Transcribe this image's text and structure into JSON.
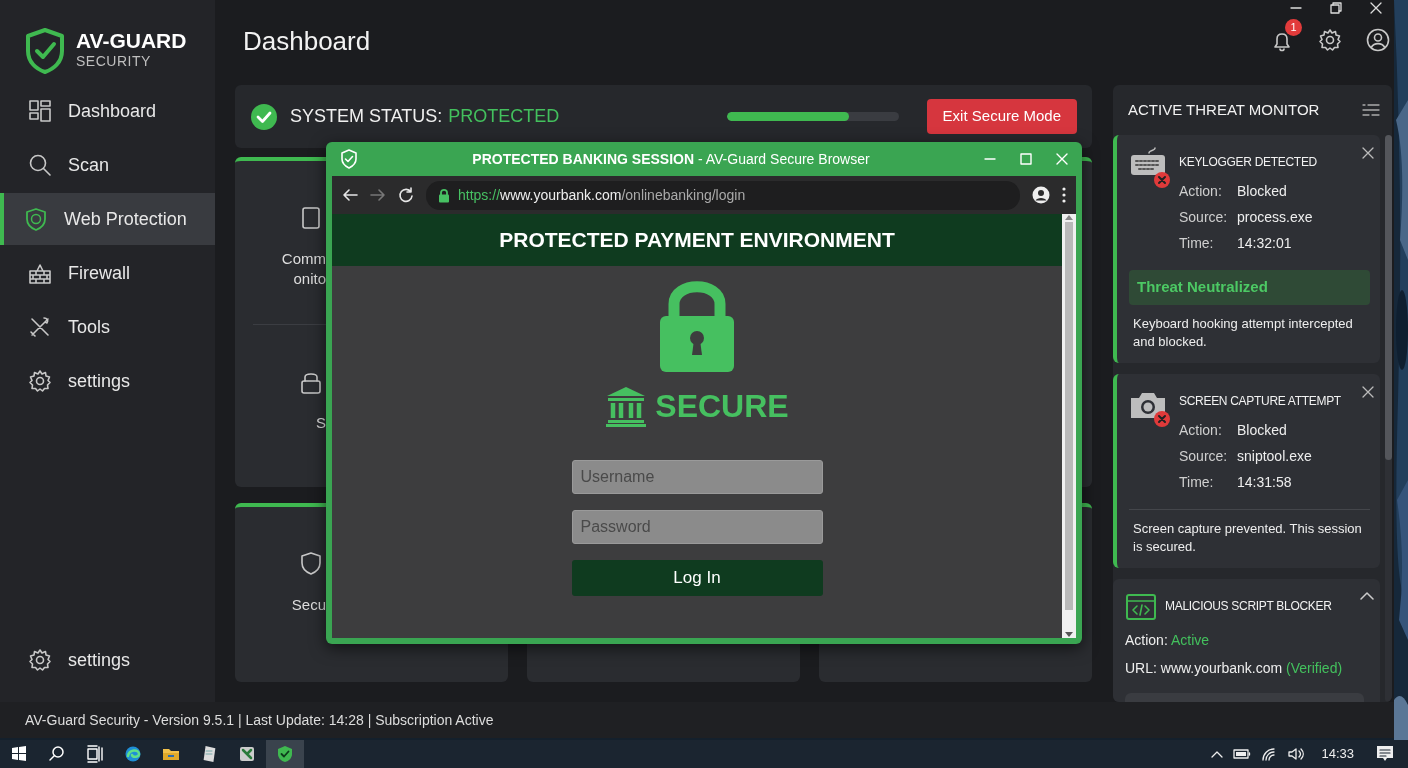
{
  "logo": {
    "title": "AV-GUARD",
    "subtitle": "SECURITY"
  },
  "sidebar": {
    "items": [
      {
        "label": "Dashboard",
        "selected": false
      },
      {
        "label": "Scan",
        "selected": false
      },
      {
        "label": "Web Protection",
        "selected": true
      },
      {
        "label": "Firewall",
        "selected": false
      },
      {
        "label": "Tools",
        "selected": false
      },
      {
        "label": "settings",
        "selected": false
      }
    ],
    "footer_item": {
      "label": "settings"
    }
  },
  "header": {
    "title": "Dashboard",
    "notifications": "1"
  },
  "status": {
    "label": "SYSTEM STATUS:",
    "value": "PROTECTED",
    "level": 0.71,
    "button": "Exit Secure Mode"
  },
  "cards": [
    {
      "kind": "labeled",
      "sections": [
        {
          "lines": [
            "Comm",
            "onito"
          ]
        },
        {
          "lines": [
            "S"
          ]
        }
      ]
    },
    {
      "kind": "blank"
    },
    {
      "kind": "labeled",
      "sections": [
        {
          "lines": [
            "Secu"
          ]
        }
      ]
    },
    {
      "kind": "blank"
    },
    {
      "kind": "blank"
    }
  ],
  "browser": {
    "title": "**PROTECTED BANKING SESSION** - AV-Guard Secure Browser",
    "nav_buttons": [
      {
        "disabled": false
      },
      {
        "disabled": true
      },
      {
        "disabled": false
      }
    ],
    "url": {
      "scheme": "https://",
      "host": "www.yourbank.com",
      "path": "/onlinebanking/login"
    },
    "page": {
      "banner": "PROTECTED PAYMENT ENVIRONMENT",
      "badge": "SECURE",
      "fields": [
        {
          "placeholder": "Username"
        },
        {
          "placeholder": "Password"
        }
      ],
      "button": "Log In"
    }
  },
  "threat_monitor": {
    "title": "ACTIVE THREAT MONITOR",
    "items": [
      {
        "kind": "alert",
        "title": "KEYLOGGER DETECTED",
        "details": [
          {
            "label": "Action:",
            "value": "Blocked"
          },
          {
            "label": "Source:",
            "value": "process.exe"
          },
          {
            "label": "Time:",
            "value": "14:32:01"
          }
        ],
        "result": "Threat Neutralized",
        "description": "Keyboard hooking attempt intercepted and blocked."
      },
      {
        "kind": "alert",
        "title": "SCREEN CAPTURE ATTEMPT",
        "details": [
          {
            "label": "Action:",
            "value": "Blocked"
          },
          {
            "label": "Source:",
            "value": "sniptool.exe"
          },
          {
            "label": "Time:",
            "value": "14:31:58"
          }
        ],
        "description": "Screen capture prevented. This session is secured."
      },
      {
        "kind": "module",
        "title": "MALICIOUS SCRIPT BLOCKER",
        "lines": [
          {
            "text": "Action:",
            "highlight": "Active"
          },
          {
            "text": "URL: www.yourbank.com",
            "highlight": "(Verified)"
          }
        ]
      }
    ]
  },
  "status_bar": "AV-Guard Security - Version 9.5.1 | Last Update: 14:28 | Subscription Active",
  "taskbar": {
    "apps": [
      {
        "selected": false
      },
      {
        "selected": false
      },
      {
        "selected": false
      },
      {
        "selected": false
      },
      {
        "selected": false
      },
      {
        "selected": false
      },
      {
        "selected": false
      },
      {
        "selected": true
      }
    ],
    "clock": "14:33"
  }
}
